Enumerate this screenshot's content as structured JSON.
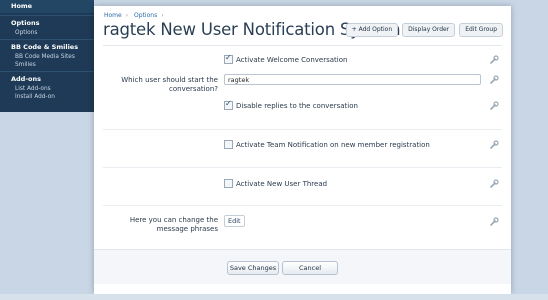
{
  "sidebar": {
    "home": "Home",
    "sections": [
      {
        "title": "Options",
        "items": [
          "Options"
        ]
      },
      {
        "title": "BB Code & Smilies",
        "items": [
          "BB Code Media Sites",
          "Smilies"
        ]
      },
      {
        "title": "Add-ons",
        "items": [
          "List Add-ons",
          "Install Add-on"
        ]
      }
    ]
  },
  "breadcrumb": [
    "Home",
    "Options"
  ],
  "page": {
    "title": "ragtek New User Notification System",
    "buttons": {
      "add_option": "+ Add Option",
      "display_order": "Display Order",
      "edit_group": "Edit Group"
    }
  },
  "form": {
    "welcome_label": "Activate Welcome Conversation",
    "which_user_label": "Which user should start the conversation?",
    "which_user_value": "ragtek",
    "disable_replies_label": "Disable replies to the conversation",
    "team_notification_label": "Activate Team Notification on new member registration",
    "new_user_thread_label": "Activate New User Thread",
    "phrases_label": "Here you can change the message phrases",
    "edit_label": "Edit"
  },
  "actions": {
    "save": "Save Changes",
    "cancel": "Cancel"
  },
  "colors": {
    "sidebar_bg": "#1e3a56",
    "link": "#2a6aa6",
    "page_bg": "#c8d6e6"
  }
}
